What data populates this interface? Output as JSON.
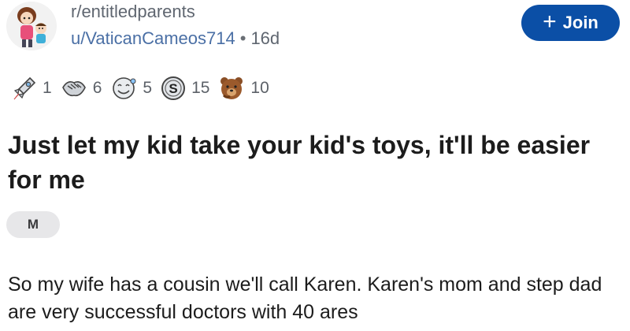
{
  "header": {
    "subreddit": "r/entitledparents",
    "username": "u/VaticanCameos714",
    "separator": "•",
    "age": "16d",
    "join_label": "Join",
    "join_icon": "plus-icon"
  },
  "awards": [
    {
      "icon": "rocket-award-icon",
      "count": "1"
    },
    {
      "icon": "handshake-award-icon",
      "count": "6"
    },
    {
      "icon": "smile-face-award-icon",
      "count": "5"
    },
    {
      "icon": "silver-coin-award-icon",
      "count": "15"
    },
    {
      "icon": "bear-award-icon",
      "count": "10"
    }
  ],
  "post": {
    "title": "Just let my kid take your kid's toys, it'll be easier for me",
    "flair": "M",
    "body": "So my wife has a cousin we'll call Karen. Karen's mom and step dad are very successful doctors with 40 ares"
  },
  "colors": {
    "join_button": "#0b4fa6",
    "username": "#4a6fa5",
    "flair_bg": "#e7e7e9"
  }
}
